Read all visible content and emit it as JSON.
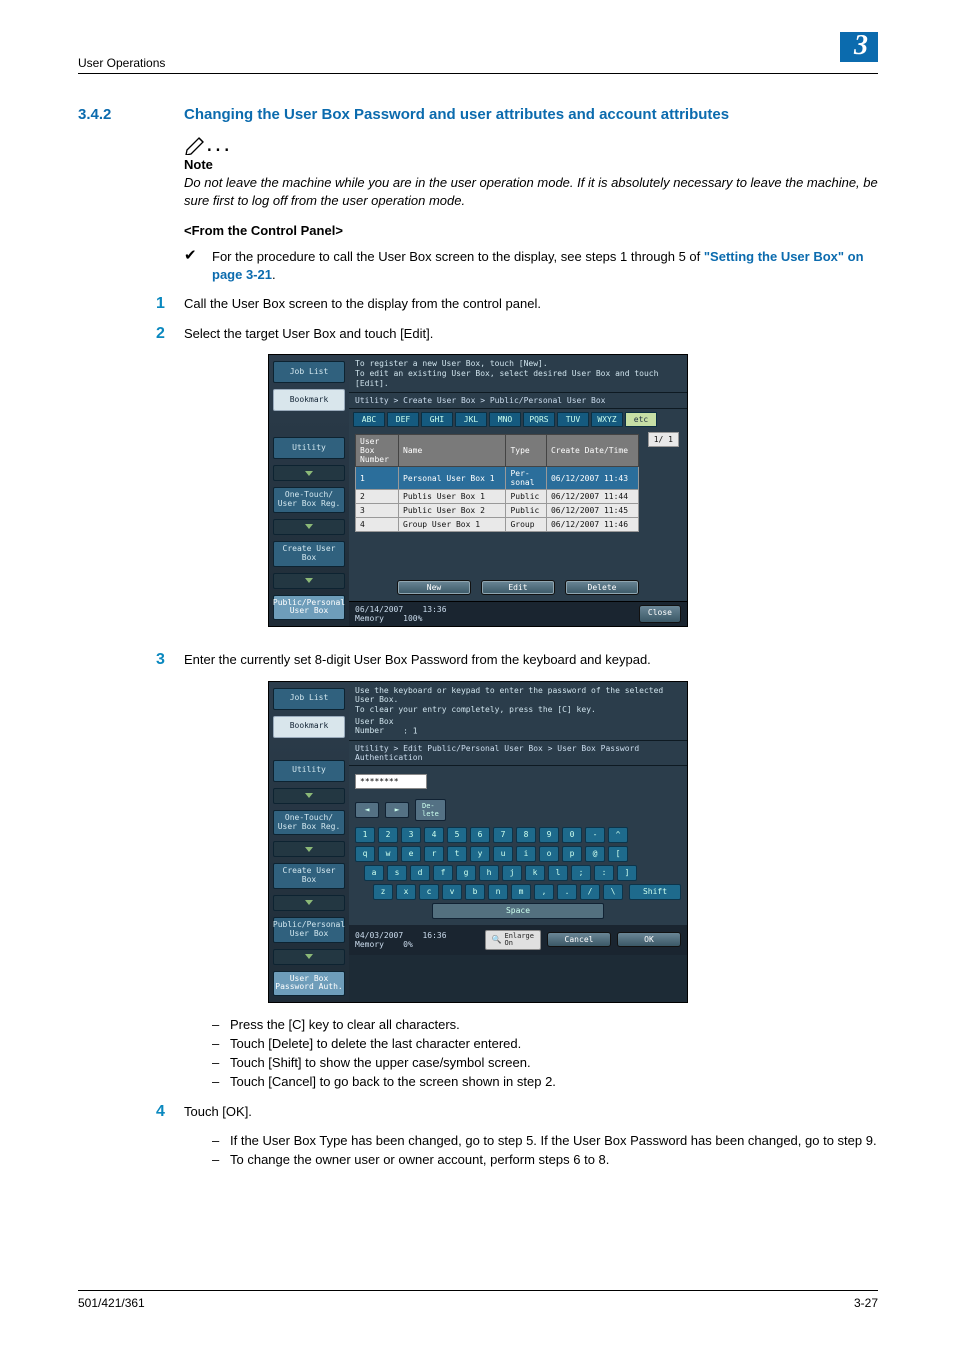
{
  "header": {
    "running": "User Operations",
    "chapter": "3"
  },
  "section": {
    "num": "3.4.2",
    "title": "Changing the User Box Password and user attributes and account attributes"
  },
  "note": {
    "label": "Note",
    "body": "Do not leave the machine while you are in the user operation mode. If it is absolutely necessary to leave the machine, be sure first to log off from the user operation mode."
  },
  "subhead1": "<From the Control Panel>",
  "check": {
    "pre": "For the procedure to call the User Box screen to the display, see steps 1 through 5 of ",
    "link": "\"Setting the User Box\" on page 3-21",
    "post": "."
  },
  "steps": {
    "s1": {
      "n": "1",
      "t": "Call the User Box screen to the display from the control panel."
    },
    "s2": {
      "n": "2",
      "t": "Select the target User Box and touch [Edit]."
    },
    "s3": {
      "n": "3",
      "t": "Enter the currently set 8-digit User Box Password from the keyboard and keypad."
    },
    "s4": {
      "n": "4",
      "t": "Touch [OK]."
    }
  },
  "sub3": {
    "a": "Press the [C] key to clear all characters.",
    "b": "Touch [Delete] to delete the last character entered.",
    "c": "Touch [Shift] to show the upper case/symbol screen.",
    "d": "Touch [Cancel] to go back to the screen shown in step 2."
  },
  "sub4": {
    "a": "If the User Box Type has been changed, go to step 5. If the User Box Password has been changed, go to step 9.",
    "b": "To change the owner user or owner account, perform steps 6 to 8."
  },
  "footer": {
    "left": "501/421/361",
    "right": "3-27"
  },
  "lcd1": {
    "side": {
      "joblist": "Job List",
      "bookmark": "Bookmark",
      "utility": "Utility",
      "onetouch": "One-Touch/\nUser Box Reg.",
      "create": "Create User Box",
      "pubpers": "Public/Personal\nUser Box"
    },
    "topmsg": "To register a new User Box, touch [New].\nTo edit an existing User Box, select desired User Box and touch [Edit].",
    "path": "Utility > Create User Box > Public/Personal User Box",
    "tabs": {
      "t0": "ABC",
      "t1": "DEF",
      "t2": "GHI",
      "t3": "JKL",
      "t4": "MNO",
      "t5": "PQRS",
      "t6": "TUV",
      "t7": "WXYZ",
      "t8": "etc"
    },
    "page": "1/ 1",
    "tbl": {
      "h0": "User Box\nNumber",
      "h1": "Name",
      "h2": "Type",
      "h3": "Create Date/Time",
      "r1": {
        "n": "1",
        "name": "Personal User Box 1",
        "type": "Per-\nsonal",
        "d": "06/12/2007 11:43"
      },
      "r2": {
        "n": "2",
        "name": "Publis User Box 1",
        "type": "Public",
        "d": "06/12/2007 11:44"
      },
      "r3": {
        "n": "3",
        "name": "Public User Box 2",
        "type": "Public",
        "d": "06/12/2007 11:45"
      },
      "r4": {
        "n": "4",
        "name": "Group User Box 1",
        "type": "Group",
        "d": "06/12/2007 11:46"
      }
    },
    "btns": {
      "new": "New",
      "edit": "Edit",
      "del": "Delete"
    },
    "status": {
      "date": "06/14/2007",
      "time": "13:36",
      "mem": "Memory",
      "pct": "100%",
      "close": "Close"
    }
  },
  "lcd2": {
    "side": {
      "joblist": "Job List",
      "bookmark": "Bookmark",
      "utility": "Utility",
      "onetouch": "One-Touch/\nUser Box Reg.",
      "create": "Create User Box",
      "pubpers": "Public/Personal\nUser Box",
      "pwauth": "User Box\nPassword Auth."
    },
    "topmsg": "Use the keyboard or keypad to enter the password of the selected User Box.\nTo clear your entry completely, press the [C] key.",
    "boxlabel": "User Box\nNumber",
    "boxnum": ": 1",
    "path": "Utility > Edit Public/Personal User Box > User Box Password Authentication",
    "pw": "********",
    "delete": "De-\nlete",
    "rows": {
      "r1": [
        "1",
        "2",
        "3",
        "4",
        "5",
        "6",
        "7",
        "8",
        "9",
        "0",
        "-",
        "^"
      ],
      "r2": [
        "q",
        "w",
        "e",
        "r",
        "t",
        "y",
        "u",
        "i",
        "o",
        "p",
        "@",
        "["
      ],
      "r3": [
        "a",
        "s",
        "d",
        "f",
        "g",
        "h",
        "j",
        "k",
        "l",
        ";",
        ":",
        "]"
      ],
      "r4": [
        "z",
        "x",
        "c",
        "v",
        "b",
        "n",
        "m",
        ",",
        ".",
        "/",
        "\\"
      ]
    },
    "shift": "Shift",
    "space": "Space",
    "status": {
      "date": "04/03/2007",
      "time": "16:36",
      "mem": "Memory",
      "pct": "0%"
    },
    "enlarge": "Enlarge\nOn",
    "cancel": "Cancel",
    "ok": "OK"
  }
}
